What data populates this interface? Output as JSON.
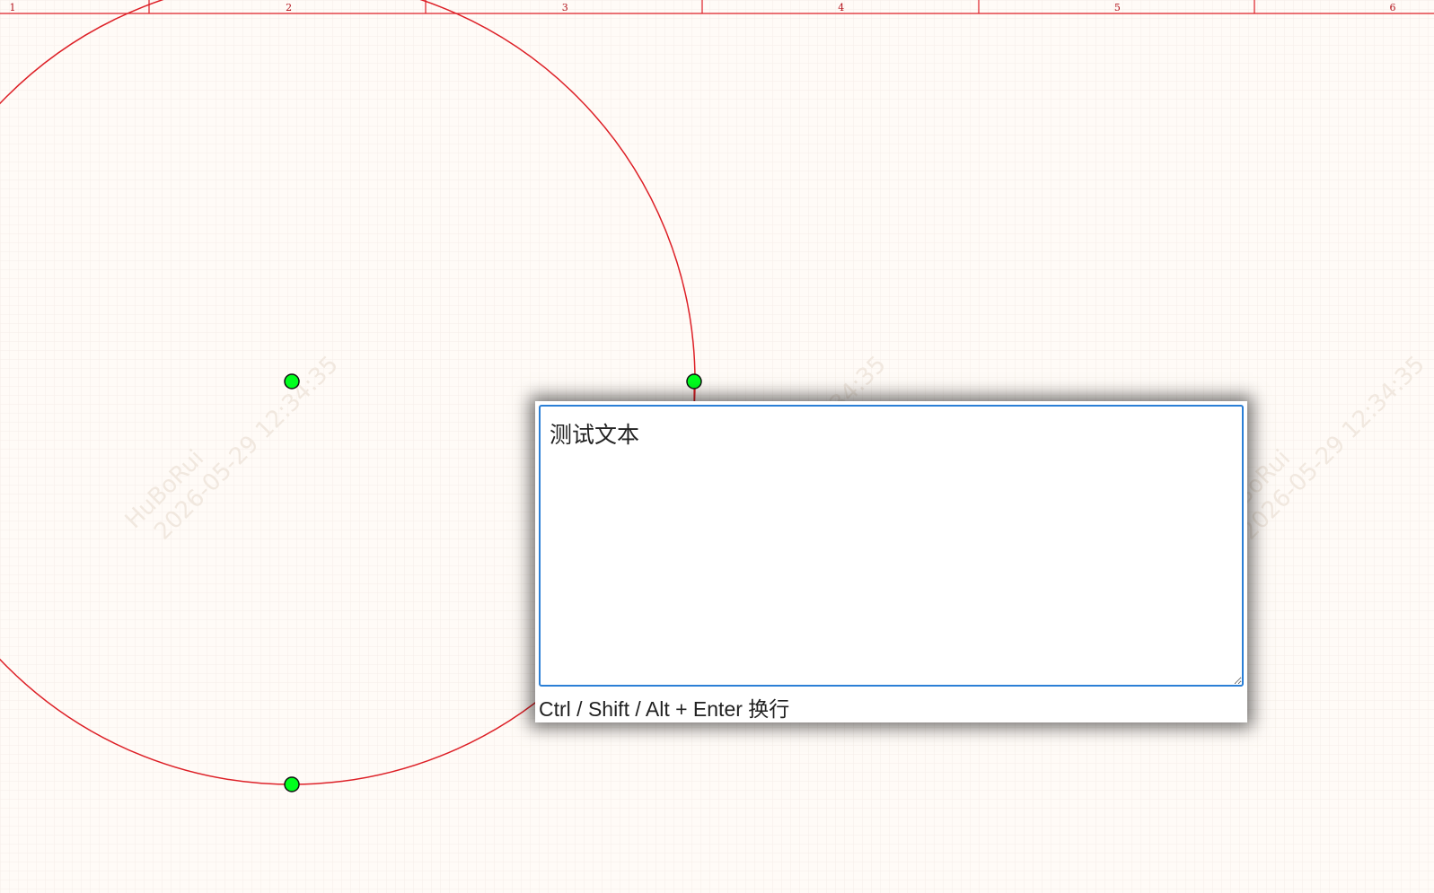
{
  "ruler": {
    "labels": [
      "1",
      "2",
      "3",
      "4",
      "5",
      "6"
    ]
  },
  "watermark": {
    "lines": [
      "HuBoRui",
      "2026-05-29 12:34:35"
    ]
  },
  "editor": {
    "value": "测试文本",
    "hint": "Ctrl / Shift / Alt + Enter 换行"
  },
  "colors": {
    "canvas_background": "#fffbf7",
    "grid": "#f3ece6",
    "ruler_and_shape": "#dd1f26",
    "handle_fill": "#00ff1e",
    "handle_stroke": "#111111",
    "editor_border": "#2b7fd6"
  },
  "icons": {
    "resize_handle": "resize-grip-icon"
  }
}
